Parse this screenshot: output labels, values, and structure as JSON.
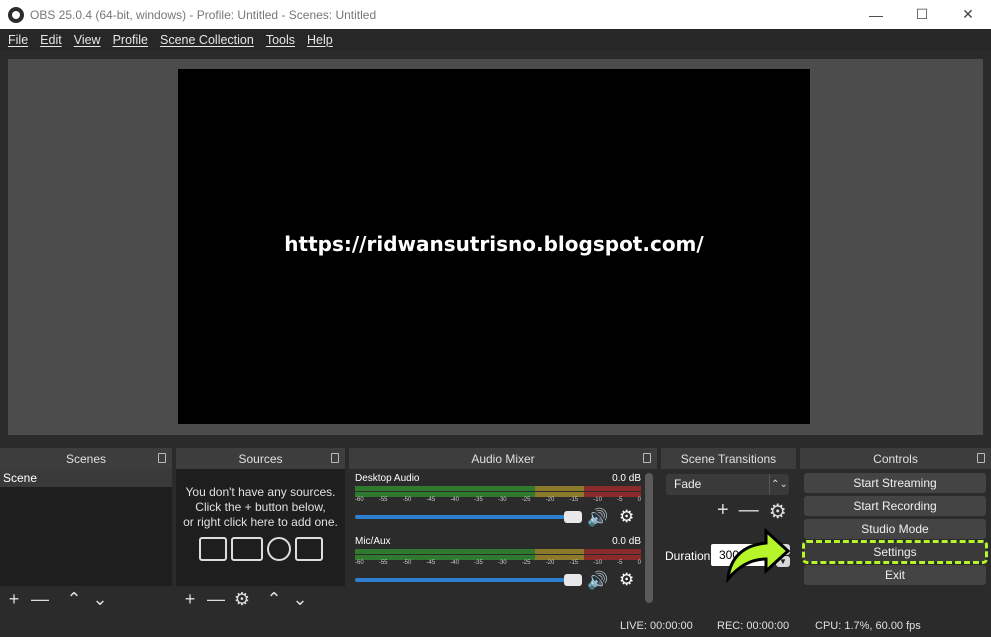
{
  "window": {
    "title": "OBS 25.0.4 (64-bit, windows) - Profile: Untitled - Scenes: Untitled",
    "minimize_glyph": "—",
    "maximize_glyph": "☐",
    "close_glyph": "✕"
  },
  "menu": [
    "File",
    "Edit",
    "View",
    "Profile",
    "Scene Collection",
    "Tools",
    "Help"
  ],
  "preview": {
    "overlay_text": "https://ridwansutrisno.blogspot.com/"
  },
  "docks": {
    "scenes": {
      "title": "Scenes",
      "items": [
        "Scene"
      ],
      "tools": [
        "+",
        "—",
        "⌃",
        "⌄"
      ]
    },
    "sources": {
      "title": "Sources",
      "empty_message": [
        "You don't have any sources.",
        "Click the + button below,",
        "or right click here to add one."
      ],
      "tools": [
        "+",
        "—",
        "⚙",
        "⌃",
        "⌄"
      ]
    },
    "audio_mixer": {
      "title": "Audio Mixer",
      "channels": [
        {
          "name": "Desktop Audio",
          "level": "0.0 dB"
        },
        {
          "name": "Mic/Aux",
          "level": "0.0 dB"
        }
      ],
      "ticks": [
        "-60",
        "-55",
        "-50",
        "-45",
        "-40",
        "-35",
        "-30",
        "-25",
        "-20",
        "-15",
        "-10",
        "-5",
        "0"
      ]
    },
    "scene_transitions": {
      "title": "Scene Transitions",
      "selected": "Fade",
      "duration_label": "Duration",
      "duration_value": "300 ms"
    },
    "controls": {
      "title": "Controls",
      "buttons": [
        "Start Streaming",
        "Start Recording",
        "Studio Mode",
        "Settings",
        "Exit"
      ]
    }
  },
  "status": {
    "live": "LIVE: 00:00:00",
    "rec": "REC: 00:00:00",
    "cpu": "CPU: 1.7%, 60.00 fps"
  },
  "colors": {
    "highlight": "#b5f52a",
    "slider": "#2f7fd0",
    "meter_green": "#3aa33a",
    "meter_yellow": "#b5a23a",
    "meter_red": "#b53a3a"
  }
}
